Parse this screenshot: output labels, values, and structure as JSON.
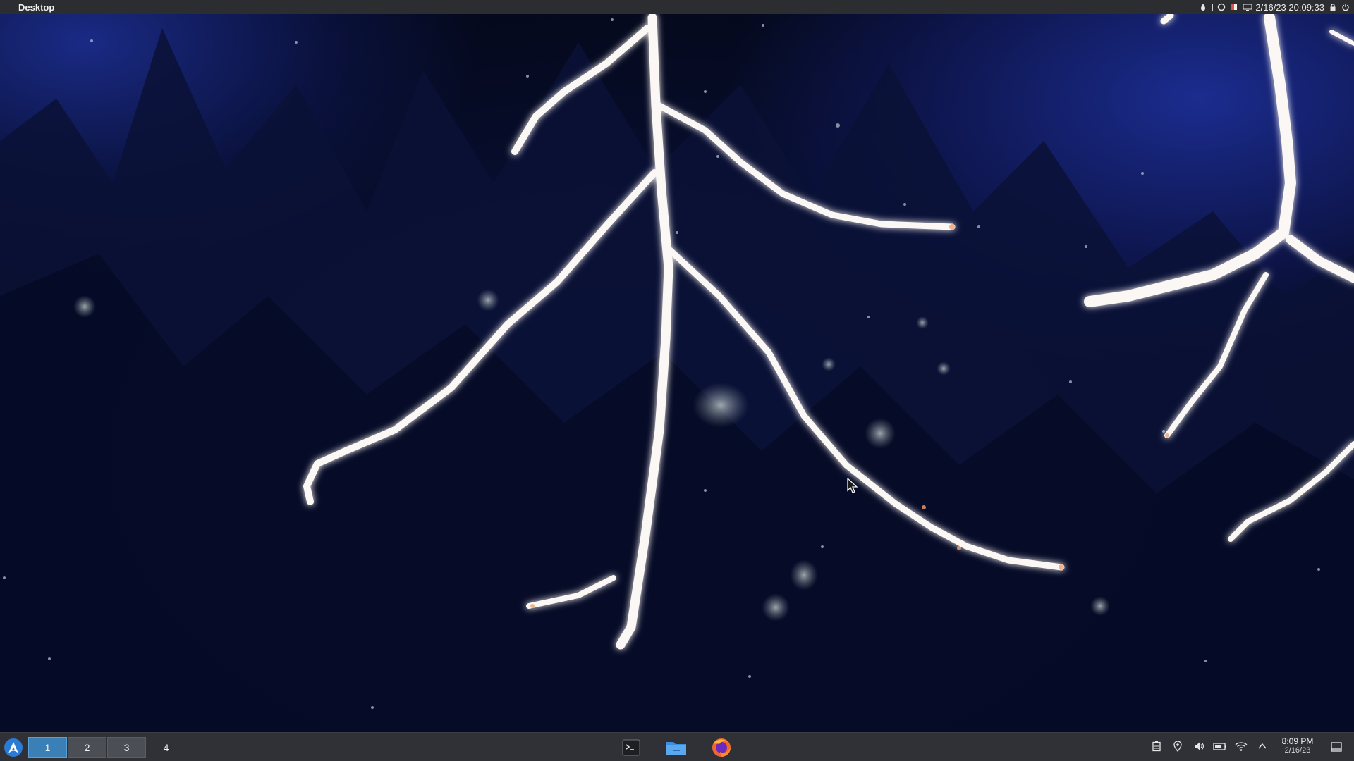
{
  "top_bar": {
    "title": "Desktop",
    "datetime": "2/16/23 20:09:33",
    "icons": [
      "droplet-icon",
      "separator",
      "circle-icon",
      "flag-icon",
      "monitor-icon",
      "lock-icon",
      "power-icon"
    ]
  },
  "taskbar": {
    "launcher_icon": "arch-logo-icon",
    "desktops": [
      {
        "label": "1",
        "active": true
      },
      {
        "label": "2",
        "active": false
      },
      {
        "label": "3",
        "active": false
      },
      {
        "label": "4",
        "active": false
      }
    ],
    "tasks": [
      "terminal-icon",
      "file-manager-icon",
      "firefox-icon"
    ],
    "tray": [
      "clipboard-icon",
      "location-icon",
      "volume-icon",
      "battery-icon",
      "wifi-icon",
      "chevron-up-icon"
    ],
    "clock_time": "8:09 PM",
    "clock_date": "2/16/23",
    "show_desktop_icon": "show-desktop-icon"
  },
  "colors": {
    "top_bar_bg": "#2b2d31",
    "taskbar_bg": "#2f3136",
    "active_desktop": "#3a7fb5",
    "launcher": "#2b7bd6"
  }
}
